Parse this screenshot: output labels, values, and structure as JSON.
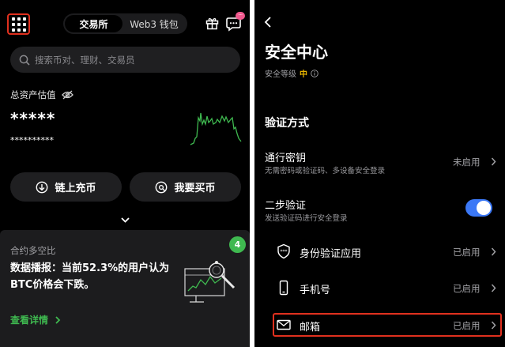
{
  "left": {
    "tabs": [
      {
        "label": "交易所",
        "active": true
      },
      {
        "label": "Web3 钱包",
        "active": false
      }
    ],
    "notification_badge": "···",
    "search": {
      "placeholder": "搜索币对、理财、交易员"
    },
    "assets": {
      "label": "总资产估值",
      "masked_value": "*****",
      "masked_secondary": "**********"
    },
    "actions": {
      "deposit_label": "链上充币",
      "buy_label": "我要买币"
    },
    "card": {
      "title": "合约多空比",
      "badge": "4",
      "text": "数据播报：当前52.3%的用户认为BTC价格会下跌。",
      "link_label": "查看详情"
    },
    "colors": {
      "accent_green": "#3fb950",
      "highlight_red": "#e0301e",
      "badge_pink": "#f0598e"
    }
  },
  "right": {
    "title": "安全中心",
    "security_level": {
      "label": "安全等级",
      "value": "中",
      "color": "#e8b500"
    },
    "section_heading": "验证方式",
    "passkey": {
      "title": "通行密钥",
      "subtitle": "无需密码或验证码、多设备安全登录",
      "status": "未启用"
    },
    "two_step": {
      "title": "二步验证",
      "subtitle": "发送验证码进行安全登录",
      "enabled": true,
      "toggle_color": "#3b78f6"
    },
    "methods": [
      {
        "icon": "shield-key-icon",
        "label": "身份验证应用",
        "status": "已启用"
      },
      {
        "icon": "phone-icon",
        "label": "手机号",
        "status": "已启用"
      },
      {
        "icon": "mail-icon",
        "label": "邮箱",
        "status": "已启用"
      }
    ]
  }
}
